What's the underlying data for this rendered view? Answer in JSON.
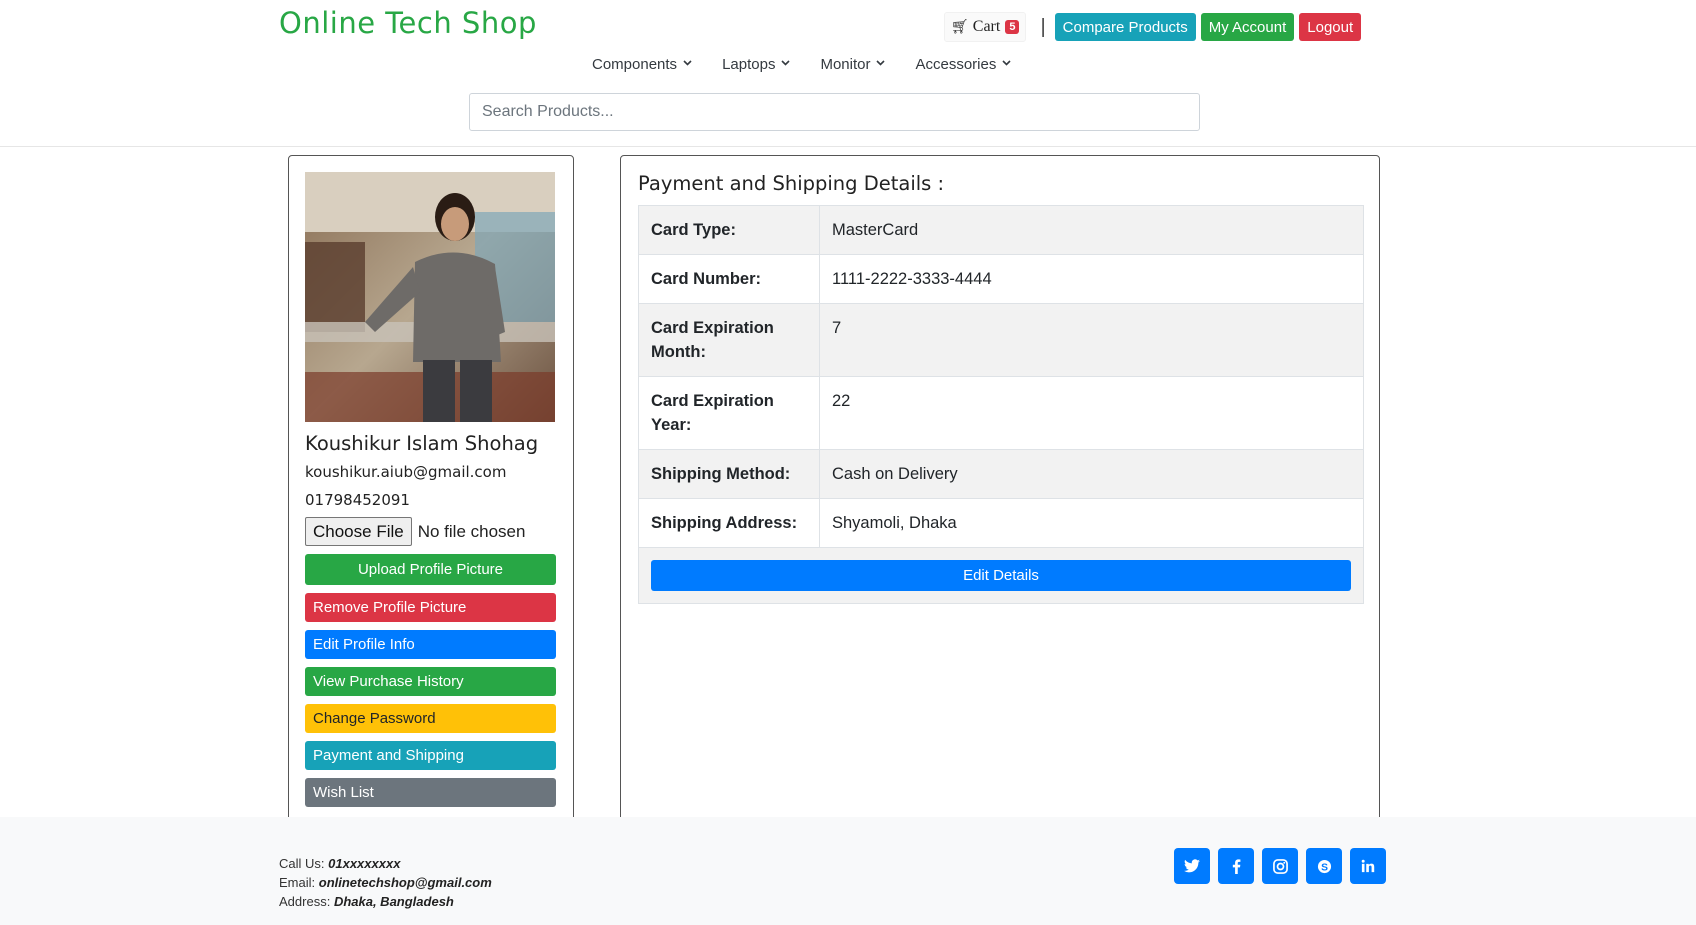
{
  "header": {
    "brand": "Online Tech Shop",
    "cart_label": "Cart",
    "cart_count": "5",
    "separator": "|",
    "compare_label": "Compare Products",
    "account_label": "My Account",
    "logout_label": "Logout"
  },
  "menu": {
    "items": [
      "Components",
      "Laptops",
      "Monitor",
      "Accessories"
    ]
  },
  "search": {
    "placeholder": "Search Products..."
  },
  "profile": {
    "name": "Koushikur Islam Shohag",
    "email": "koushikur.aiub@gmail.com",
    "phone": "01798452091",
    "file_button": "Choose File",
    "file_status": "No file chosen",
    "buttons": {
      "upload": "Upload Profile Picture",
      "remove": "Remove Profile Picture",
      "edit": "Edit Profile Info",
      "history": "View Purchase History",
      "password": "Change Password",
      "payment": "Payment and Shipping",
      "wishlist": "Wish List"
    }
  },
  "details": {
    "title": "Payment and Shipping Details :",
    "rows": [
      {
        "label": "Card Type:",
        "value": "MasterCard"
      },
      {
        "label": "Card Number:",
        "value": "1111-2222-3333-4444"
      },
      {
        "label": "Card Expiration Month:",
        "value": "7"
      },
      {
        "label": "Card Expiration Year:",
        "value": "22"
      },
      {
        "label": "Shipping Method:",
        "value": "Cash on Delivery"
      },
      {
        "label": "Shipping Address:",
        "value": "Shyamoli, Dhaka"
      }
    ],
    "edit_button": "Edit Details"
  },
  "footer": {
    "call_label": "Call Us:",
    "call_value": "01xxxxxxxx",
    "email_label": "Email:",
    "email_value": "onlinetechshop@gmail.com",
    "address_label": "Address:",
    "address_value": "Dhaka, Bangladesh",
    "social_icons": [
      "twitter-icon",
      "facebook-icon",
      "instagram-icon",
      "skype-icon",
      "linkedin-icon"
    ]
  },
  "colors": {
    "brand": "#28a745",
    "primary": "#007bff",
    "info": "#17a2b8",
    "danger": "#dc3545",
    "warning": "#ffc107",
    "secondary": "#6c757d"
  }
}
